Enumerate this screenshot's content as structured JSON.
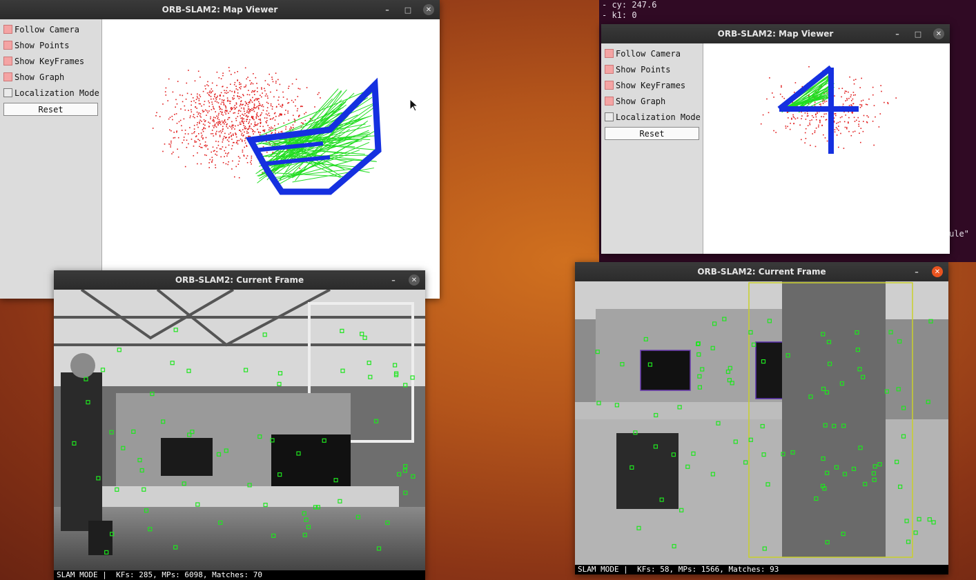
{
  "terminal": {
    "lines": [
      "- cy: 247.6",
      "- k1: 0"
    ],
    "fragment": "ule\""
  },
  "map_viewer_1": {
    "title": "ORB-SLAM2: Map Viewer",
    "menu": [
      {
        "label": "Follow Camera",
        "checked": true
      },
      {
        "label": "Show Points",
        "checked": true
      },
      {
        "label": "Show KeyFrames",
        "checked": true
      },
      {
        "label": "Show Graph",
        "checked": true
      },
      {
        "label": "Localization Mode",
        "checked": false
      }
    ],
    "reset_label": "Reset"
  },
  "map_viewer_2": {
    "title": "ORB-SLAM2: Map Viewer",
    "menu": [
      {
        "label": "Follow Camera",
        "checked": true
      },
      {
        "label": "Show Points",
        "checked": true
      },
      {
        "label": "Show KeyFrames",
        "checked": true
      },
      {
        "label": "Show Graph",
        "checked": true
      },
      {
        "label": "Localization Mode",
        "checked": false
      }
    ],
    "reset_label": "Reset"
  },
  "current_frame_1": {
    "title": "ORB-SLAM2: Current Frame",
    "status": "SLAM MODE |  KFs: 285, MPs: 6098, Matches: 70"
  },
  "current_frame_2": {
    "title": "ORB-SLAM2: Current Frame",
    "status": "SLAM MODE |  KFs: 58, MPs: 1566, Matches: 93"
  },
  "window_buttons": {
    "minimize": "–",
    "maximize": "□",
    "close": "✕"
  },
  "colors": {
    "map_point": "#e01818",
    "keyframe": "#1530e0",
    "graph_edge": "#22dd22",
    "feature_marker": "#1fe61f",
    "accent_close": "#e95420"
  }
}
